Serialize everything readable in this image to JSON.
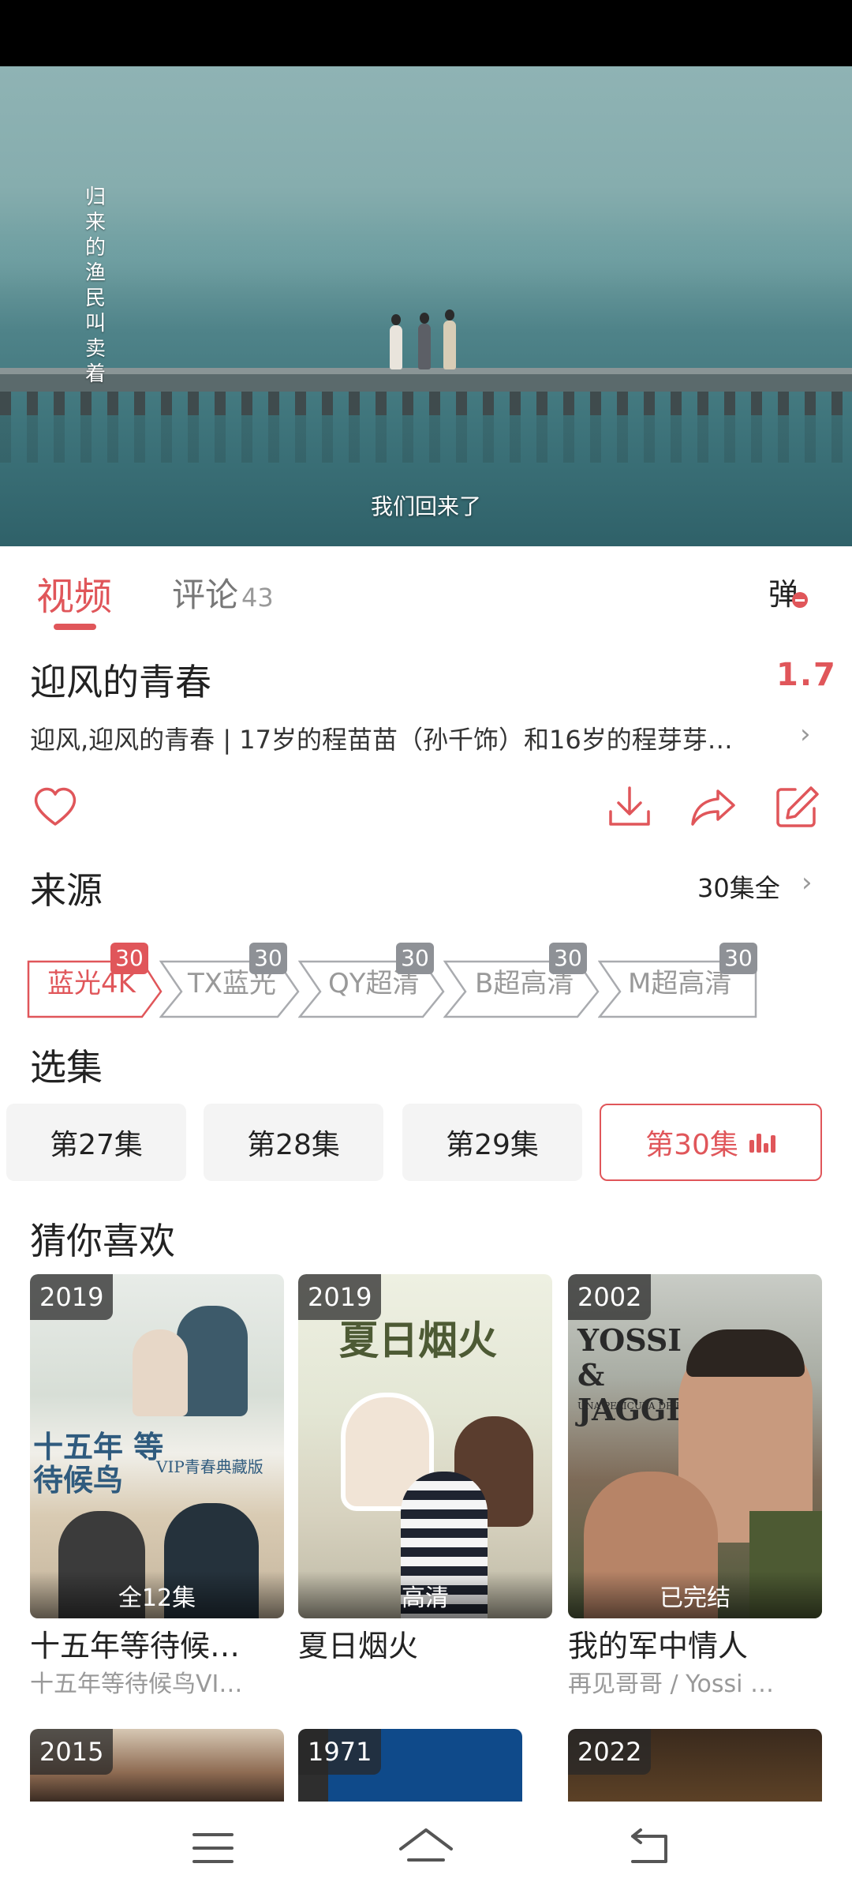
{
  "player": {
    "vertical_caption": [
      "归",
      "来",
      "的",
      "渔",
      "民",
      "叫",
      "卖",
      "着"
    ],
    "subtitle": "我们回来了"
  },
  "tabs": {
    "video_label": "视频",
    "comments_label": "评论",
    "comments_count": "43",
    "danmaku_label": "弹"
  },
  "show": {
    "title": "迎风的青春",
    "score": "1.7",
    "description": "迎风,迎风的青春 | 17岁的程苗苗（孙千饰）和16岁的程芽芽…"
  },
  "sources": {
    "title": "来源",
    "episodes_all": "30集全",
    "items": [
      {
        "label": "蓝光4K",
        "count": "30",
        "active": true
      },
      {
        "label": "TX蓝光",
        "count": "30",
        "active": false
      },
      {
        "label": "QY超清",
        "count": "30",
        "active": false
      },
      {
        "label": "B超高清",
        "count": "30",
        "active": false
      },
      {
        "label": "M超高清",
        "count": "30",
        "active": false
      }
    ]
  },
  "episodes": {
    "title": "选集",
    "items": [
      {
        "label": "第27集",
        "active": false
      },
      {
        "label": "第28集",
        "active": false
      },
      {
        "label": "第29集",
        "active": false
      },
      {
        "label": "第30集",
        "active": true
      }
    ]
  },
  "recommendations": {
    "title": "猜你喜欢",
    "items": [
      {
        "year": "2019",
        "ribbon": "全12集",
        "title": "十五年等待候…",
        "subtitle": "十五年等待候鸟VI…",
        "poster_text": "十五年 等待候鸟",
        "poster_tag": "VIP青春典藏版"
      },
      {
        "year": "2019",
        "ribbon": "高清",
        "title": "夏日烟火",
        "subtitle": "",
        "poster_text": "夏日烟火"
      },
      {
        "year": "2002",
        "ribbon": "已完结",
        "title": "我的军中情人",
        "subtitle": "再见哥哥 / Yossi …",
        "poster_text": "YOSSI & JAGGER",
        "poster_tag": "UNA PELICULA DE EYTAN FOX"
      },
      {
        "year": "2015"
      },
      {
        "year": "1971"
      },
      {
        "year": "2022"
      }
    ]
  },
  "colors": {
    "accent": "#e0565a",
    "gray_badge": "#8e9196"
  },
  "icons": [
    "heart-icon",
    "download-icon",
    "share-icon",
    "edit-icon",
    "chevron-right-icon",
    "menu-icon",
    "home-icon",
    "back-icon"
  ]
}
